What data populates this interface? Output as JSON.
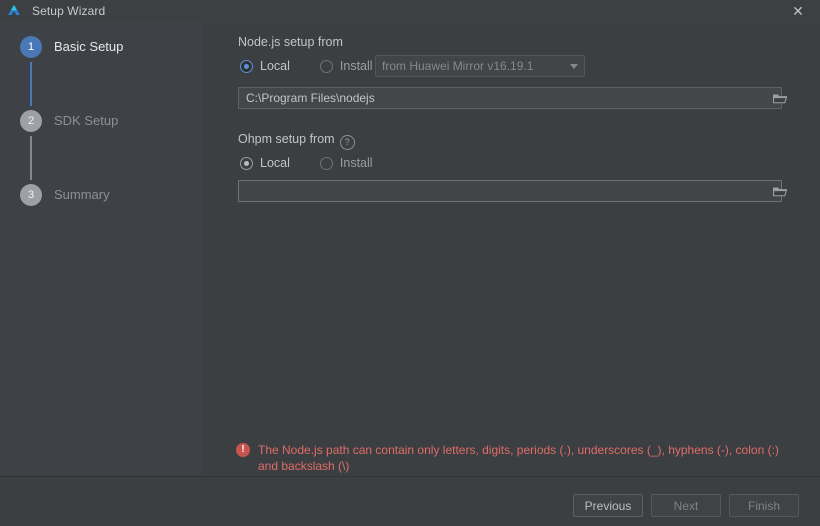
{
  "titlebar": {
    "logo_icon": "deveco-logo-icon",
    "title": "Setup Wizard",
    "close_icon": "✕"
  },
  "sidebar": {
    "steps": [
      {
        "number": "1",
        "label": "Basic Setup",
        "state": "active"
      },
      {
        "number": "2",
        "label": "SDK Setup",
        "state": "inactive"
      },
      {
        "number": "3",
        "label": "Summary",
        "state": "inactive"
      }
    ]
  },
  "main": {
    "nodejs": {
      "section_label": "Node.js setup from",
      "radio_local": "Local",
      "radio_install": "Install",
      "selected": "Local",
      "mirror_combo_value": "from Huawei Mirror v16.19.1",
      "path_value": "C:\\Program Files\\nodejs",
      "browse_icon": "folder-icon"
    },
    "ohpm": {
      "section_label": "Ohpm setup from",
      "help_icon": "?",
      "radio_local": "Local",
      "radio_install": "Install",
      "selected": "Local",
      "path_value": "",
      "path_placeholder": "",
      "browse_icon": "folder-icon"
    },
    "error": {
      "icon": "!",
      "message": "The Node.js path can contain only letters, digits, periods (.), underscores (_), hyphens (-), colon (:) and backslash (\\)"
    }
  },
  "footer": {
    "previous_label": "Previous",
    "next_label": "Next",
    "finish_label": "Finish"
  },
  "colors": {
    "accent_blue": "#4a77b5",
    "error_red": "#e06c68",
    "sidebar_bg": "#3e4247",
    "content_bg": "#3c3f41"
  }
}
